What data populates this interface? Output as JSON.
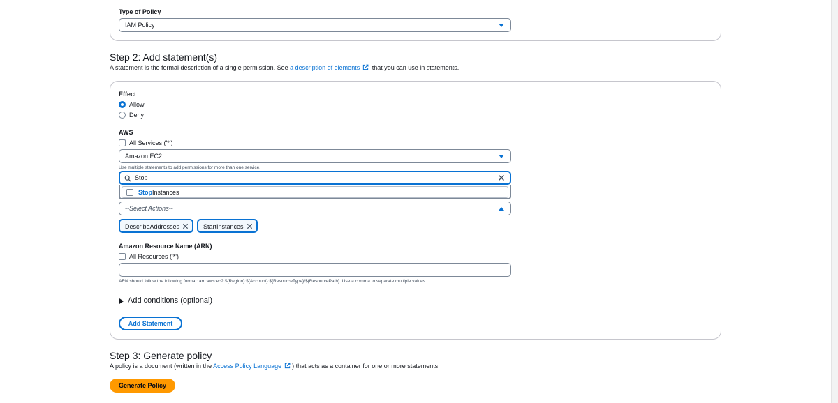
{
  "step1": {
    "policy_type_label": "Type of Policy",
    "policy_type_value": "IAM Policy"
  },
  "step2": {
    "title": "Step 2: Add statement(s)",
    "desc_prefix": "A statement is the formal description of a single permission. See ",
    "desc_link": "a description of elements",
    "desc_suffix": " that you can use in statements."
  },
  "statement": {
    "effect_label": "Effect",
    "effect_options": [
      "Allow",
      "Deny"
    ],
    "effect_selected": "Allow",
    "aws_label": "AWS",
    "all_services_label": "All Services ('*')",
    "all_services_checked": false,
    "service_value": "Amazon EC2",
    "service_hint": "Use multiple statements to add permissions for more than one service.",
    "action_search_value": "Stop",
    "action_option_match": "Stop",
    "action_option_rest": "Instances",
    "actions_placeholder": "--Select Actions--",
    "selected_actions": [
      "DescribeAddresses",
      "StartInstances"
    ],
    "arn_label": "Amazon Resource Name (ARN)",
    "all_resources_label": "All Resources ('*')",
    "all_resources_checked": false,
    "arn_value": "",
    "arn_hint": "ARN should follow the following format: arn:aws:ec2:${Region}:${Account}:${ResourceType}/${ResourcePath}. Use a comma to separate multiple values.",
    "conditions_label": "Add conditions (optional)",
    "add_statement_label": "Add Statement"
  },
  "step3": {
    "title": "Step 3: Generate policy",
    "desc_prefix": "A policy is a document (written in the ",
    "desc_link": "Access Policy Language",
    "desc_suffix": ") that acts as a container for one or more statements.",
    "generate_label": "Generate Policy"
  },
  "colors": {
    "accent": "#0972d3",
    "primary_button": "#ff9900",
    "text": "#16191f",
    "border": "#7d8998"
  },
  "icons": [
    "caret-down-icon",
    "caret-up-icon",
    "external-link-icon",
    "search-icon",
    "clear-icon",
    "remove-token-icon",
    "expand-triangle-icon"
  ]
}
